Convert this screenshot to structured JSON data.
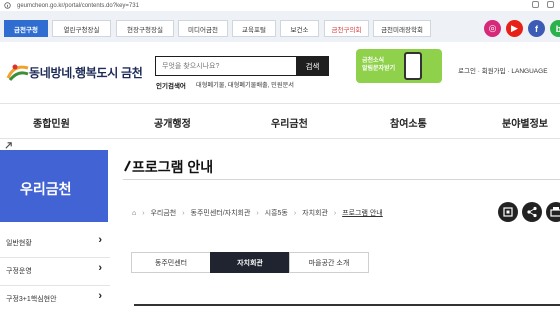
{
  "browser": {
    "url": "geumcheon.go.kr/portal/contents.do?key=731"
  },
  "gov_bar": {
    "tabs": [
      "금천구청",
      "열린구청장실",
      "현장구청장실",
      "미디어금천",
      "교육포털",
      "보건소",
      "금천구의회",
      "금천미래장학회"
    ]
  },
  "social": {
    "instagram": "◎",
    "youtube": "▶",
    "facebook": "f",
    "blog": "b"
  },
  "header": {
    "site_title": "동네방네,행복도시 금천",
    "search_placeholder": "무엇을 찾으시나요?",
    "search_button": "검색",
    "popular_label": "인기검색어",
    "popular_terms": "대형폐기물, 대형폐기물배출, 민원문서",
    "banner_text_1": "금천소식",
    "banner_text_2": "알림문자받기",
    "top_links": "로그인 · 회원가입 · LANGUAGE"
  },
  "nav": {
    "items": [
      "종합민원",
      "공개행정",
      "우리금천",
      "참여소통",
      "분야별정보"
    ]
  },
  "sidebar": {
    "heading": "우리금천",
    "items": [
      "일반현황",
      "구정운영",
      "구정3+1핵심현안"
    ]
  },
  "content": {
    "title": "프로그램 안내",
    "breadcrumb": [
      "우리금천",
      "동주민센터/자치회관",
      "시흥5동",
      "자치회관",
      "프로그램 안내"
    ],
    "tabs": [
      "동주민센터",
      "자치회관",
      "마을공간 소개"
    ],
    "active_tab_index": 1
  },
  "colors": {
    "sidebar_bg": "#4263d4",
    "active_tab_bg": "#1f2430",
    "home_tab_bg": "#2f6ed0",
    "banner_bg": "#8fd14a"
  }
}
